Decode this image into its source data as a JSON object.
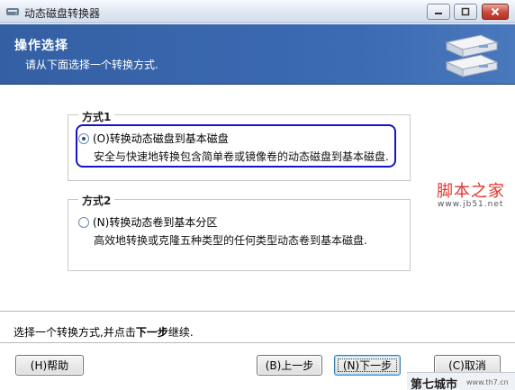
{
  "window": {
    "title": "动态磁盘转换器",
    "icon": "app-disk-icon",
    "controls": [
      "minimize-icon",
      "maximize-icon",
      "close-icon"
    ]
  },
  "header": {
    "title": "操作选择",
    "subtitle": "请从下面选择一个转换方式.",
    "graphic": "disk-drives-icon"
  },
  "groups": [
    {
      "legend": "方式1",
      "option": {
        "label": "(O)转换动态磁盘到基本磁盘",
        "description": "安全与快速地转换包含简单卷或镜像卷的动态磁盘到基本磁盘.",
        "checked": true
      }
    },
    {
      "legend": "方式2",
      "option": {
        "label": "(N)转换动态卷到基本分区",
        "description": "高效地转换或克隆五种类型的任何类型动态卷到基本磁盘.",
        "checked": false
      }
    }
  ],
  "instruction": {
    "prefix": "选择一个转换方式,并点击",
    "bold": "下一步",
    "suffix": "继续."
  },
  "buttons": {
    "help": "(H)帮助",
    "back": "(B)上一步",
    "next": "(N)下一步",
    "cancel": "(C)取消"
  },
  "watermarks": {
    "right_main": "脚本之家",
    "right_url": "www.jb51.net",
    "corner_main": "第七城市",
    "corner_url": "www.th7.cn"
  },
  "colors": {
    "header_blue": "#3c6bb4",
    "focus_ring": "#1515c8",
    "watermark_red": "#e3342d"
  }
}
